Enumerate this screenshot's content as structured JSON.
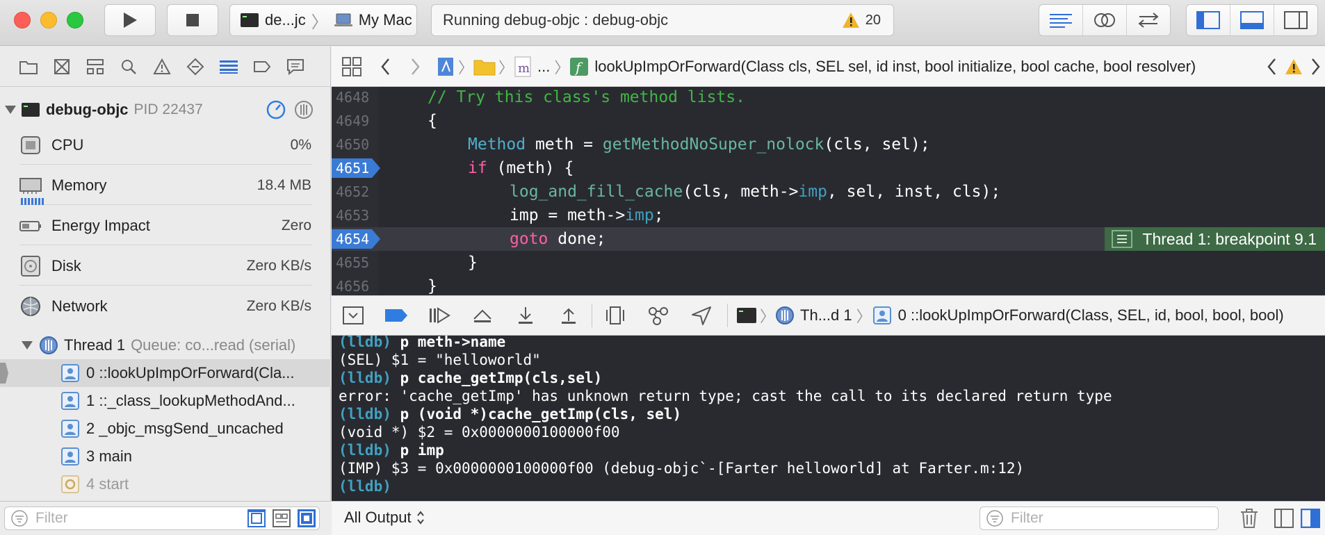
{
  "toolbar": {
    "scheme_name": "de...jc",
    "destination": "My Mac",
    "activity_status": "Running debug-objc : debug-objc",
    "warning_count": "20"
  },
  "navigator": {
    "process_name": "debug-objc",
    "process_pid": "PID 22437",
    "gauges": [
      {
        "name": "CPU",
        "value": "0%"
      },
      {
        "name": "Memory",
        "value": "18.4 MB"
      },
      {
        "name": "Energy Impact",
        "value": "Zero"
      },
      {
        "name": "Disk",
        "value": "Zero KB/s"
      },
      {
        "name": "Network",
        "value": "Zero KB/s"
      }
    ],
    "thread_name": "Thread 1",
    "thread_queue": "Queue: co...read (serial)",
    "frames": [
      {
        "label": "0 ::lookUpImpOrForward(Cla..."
      },
      {
        "label": "1 ::_class_lookupMethodAnd..."
      },
      {
        "label": "2 _objc_msgSend_uncached"
      },
      {
        "label": "3 main"
      },
      {
        "label": "4 start"
      }
    ],
    "filter_placeholder": "Filter"
  },
  "jumpbar": {
    "ellipsis": "...",
    "function_signature": "lookUpImpOrForward(Class cls, SEL sel, id inst, bool initialize, bool cache, bool resolver)"
  },
  "editor": {
    "lines": [
      {
        "num": "4648",
        "code": "// Try this class's method lists."
      },
      {
        "num": "4649",
        "code": "{"
      },
      {
        "num": "4650",
        "code_type": "Method",
        "code_mid": " meth = ",
        "code_fn": "getMethodNoSuper_nolock",
        "code_rest": "(cls, sel);"
      },
      {
        "num": "4651",
        "code_kw": "if",
        "code_rest": " (meth) {"
      },
      {
        "num": "4652",
        "code_fn": "log_and_fill_cache",
        "code_a": "(cls, meth->",
        "code_member": "imp",
        "code_rest": ", sel, inst, cls);"
      },
      {
        "num": "4653",
        "code_a": "imp = meth->",
        "code_member": "imp",
        "code_rest": ";"
      },
      {
        "num": "4654",
        "code_kw": "goto",
        "code_rest": " done;"
      },
      {
        "num": "4655",
        "code": "}"
      },
      {
        "num": "4656",
        "code": "}"
      }
    ],
    "breakpoint_label": "Thread 1: breakpoint 9.1"
  },
  "debugbar": {
    "thread_label": "Th...d 1",
    "frame_label": "0 ::lookUpImpOrForward(Class, SEL, id, bool, bool, bool)"
  },
  "console": {
    "prompt": "(lldb)",
    "cmd1": "p meth->name",
    "out1": "(SEL) $1 = \"helloworld\"",
    "cmd2": "p cache_getImp(cls,sel)",
    "out2": "error: 'cache_getImp' has unknown return type; cast the call to its declared return type",
    "cmd3": "p (void *)cache_getImp(cls, sel)",
    "out3": "(void *) $2 = 0x0000000100000f00",
    "cmd4": "p imp",
    "out4": "(IMP) $3 = 0x0000000100000f00 (debug-objc`-[Farter helloworld] at Farter.m:12)"
  },
  "console_bar": {
    "output_selector": "All Output",
    "filter_placeholder": "Filter"
  },
  "colors": {
    "editor_bg": "#292a30",
    "comment": "#41b645",
    "keyword": "#fc5fa3",
    "type": "#4eb0cc",
    "lldb_prompt": "#41a1c0",
    "breakpoint": "#3a7bd5",
    "breakpoint_badge": "#3e6a46"
  }
}
